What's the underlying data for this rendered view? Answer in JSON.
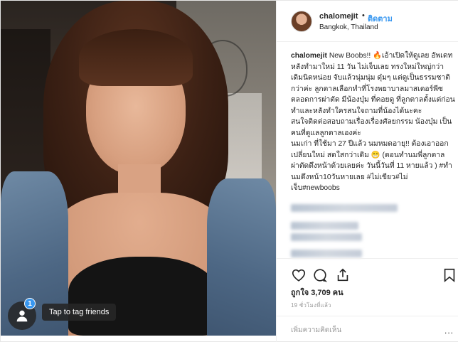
{
  "photo": {
    "tag_badge_count": "1",
    "tag_tooltip": "Tap to tag friends",
    "tag_icon": "tag-person-icon"
  },
  "header": {
    "username": "chalomejit",
    "separator": "•",
    "follow_label": "ติดตาม",
    "location": "Bangkok, Thailand"
  },
  "caption": {
    "username": "chalomejit",
    "paragraphs": [
      "New Boobs!! 🔥เอ้าเปิดให้ดูเลย อัพเดทหลังทำมาใหม่ 11 วัน ไม่เจ็บเลย ทรงใหม่ใหญ่กว่าเดิมนิดหน่อย จับแล้วนุ่มนุ่ม ดุ๋มๆ แต่ดูเป็นธรรมชาติกว่าค่ะ ลูกตาลเลือกทำที่โรงพยาบาลมาสเตอร์พีซ",
      "ตลอดการผ่าตัด มีน้องบุ๋ม ที่คอยดู ที่ลูกตาลตั้งแต่ก่อนทำและหลังทำใครสนใจถามที่น้องได้นะคะ",
      "สนใจติดต่อสอบถามเรื่องเรื่องศัลยกรรม น้องบุ๋ม เป็นคนที่ดูแลลูกตาลเองค่ะ",
      "นมเก่า ที่ใช้มา 27 ปีแล้ว นมหมดอายุ!! ต้องเอาออกเปลี่ยนใหม่ สดใสกว่าเดิม 😁 (ตอนทำนมพี่ลูกตาลผ่าตัดดึงหน้าด้วยเลยค่ะ วันนี้วันที่ 11 หายแล้ว ) #ทำนมดึงหน้า10วันหายเลย #ไม่เขียว#ไม่เจ็บ#newboobs"
    ]
  },
  "actions": {
    "like_icon": "heart-icon",
    "comment_icon": "comment-icon",
    "share_icon": "share-icon",
    "save_icon": "bookmark-icon"
  },
  "likes": "ถูกใจ 3,709 คน",
  "timestamp": "19 ชั่วโมงที่แล้ว",
  "comment": {
    "placeholder": "เพิ่มความคิดเห็น",
    "more": "..."
  },
  "colors": {
    "link_blue": "#3897f0",
    "text": "#262626",
    "muted": "#999999",
    "border": "#efefef"
  }
}
